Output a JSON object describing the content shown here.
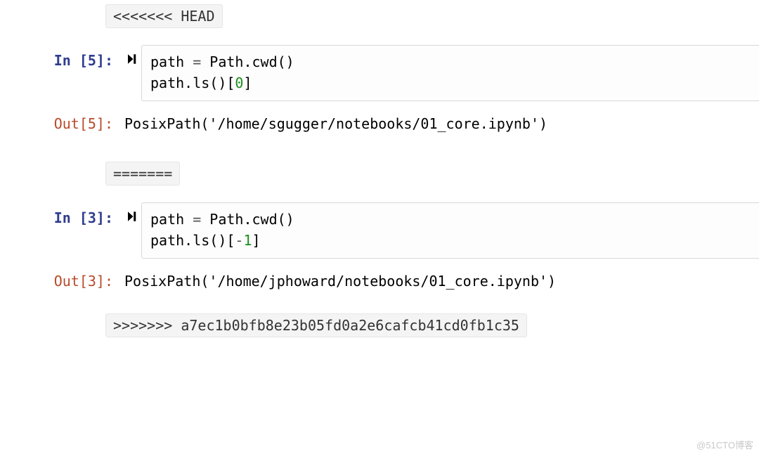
{
  "conflict": {
    "marker_head": "<<<<<<< HEAD",
    "marker_sep": "=======",
    "marker_tail": ">>>>>>> a7ec1b0bfb8e23b05fd0a2e6cafcb41cd0fb1c35"
  },
  "cells": [
    {
      "in_prompt": "In [5]:",
      "out_prompt": "Out[5]:",
      "code_line1_pre": "path ",
      "code_line1_op": "=",
      "code_line1_post": " Path.cwd()",
      "code_line2_pre": "path.ls()[",
      "code_line2_idx": "0",
      "code_line2_post": "]",
      "output": "PosixPath('/home/sgugger/notebooks/01_core.ipynb')"
    },
    {
      "in_prompt": "In [3]:",
      "out_prompt": "Out[3]:",
      "code_line1_pre": "path ",
      "code_line1_op": "=",
      "code_line1_post": " Path.cwd()",
      "code_line2_pre": "path.ls()[",
      "code_line2_idx": "-1",
      "code_line2_post": "]",
      "output": "PosixPath('/home/jphoward/notebooks/01_core.ipynb')"
    }
  ],
  "watermark": "@51CTO博客"
}
